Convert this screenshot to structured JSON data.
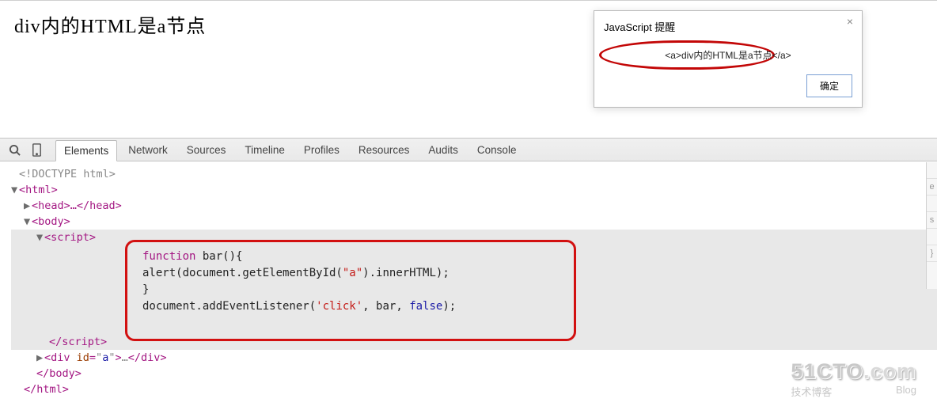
{
  "page": {
    "heading": "div内的HTML是a节点"
  },
  "alert": {
    "title": "JavaScript 提醒",
    "message": "<a>div内的HTML是a节点</a>",
    "ok_label": "确定",
    "close_label": "×"
  },
  "devtools": {
    "tabs": {
      "elements": "Elements",
      "network": "Network",
      "sources": "Sources",
      "timeline": "Timeline",
      "profiles": "Profiles",
      "resources": "Resources",
      "audits": "Audits",
      "console": "Console"
    },
    "active_tab": "elements"
  },
  "dom": {
    "doctype": "<!DOCTYPE html>",
    "html_open": "<html>",
    "head_collapsed": "<head>…</head>",
    "body_open": "<body>",
    "script_open": "<script>",
    "script_close": "</script>",
    "div_a": "<div id=\"a\">…</div>",
    "body_close": "</body>",
    "html_close": "</html>"
  },
  "script_src": {
    "l1": "function bar(){",
    "l2": "    alert(document.getElementById(\"a\").innerHTML);",
    "l3": "}",
    "l4": "document.addEventListener('click', bar, false);"
  },
  "watermark": {
    "big_a": "51CTO",
    "big_b": ".com",
    "sub_a": "技术博客",
    "sub_b": "Blog"
  }
}
